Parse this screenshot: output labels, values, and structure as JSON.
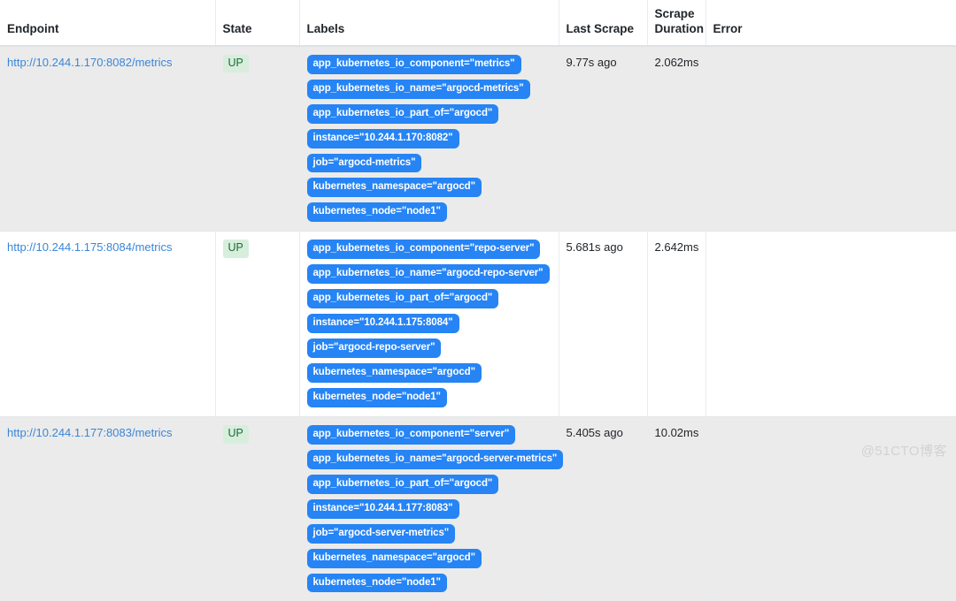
{
  "table": {
    "columns": [
      {
        "key": "endpoint",
        "label": "Endpoint"
      },
      {
        "key": "state",
        "label": "State"
      },
      {
        "key": "labels",
        "label": "Labels"
      },
      {
        "key": "last_scrape",
        "label": "Last Scrape"
      },
      {
        "key": "scrape_duration",
        "label": "Scrape Duration"
      },
      {
        "key": "error",
        "label": "Error"
      }
    ],
    "rows": [
      {
        "endpoint": "http://10.244.1.170:8082/metrics",
        "state": "UP",
        "labels": [
          "app_kubernetes_io_component=\"metrics\"",
          "app_kubernetes_io_name=\"argocd-metrics\"",
          "app_kubernetes_io_part_of=\"argocd\"",
          "instance=\"10.244.1.170:8082\"",
          "job=\"argocd-metrics\"",
          "kubernetes_namespace=\"argocd\"",
          "kubernetes_node=\"node1\""
        ],
        "last_scrape": "9.77s ago",
        "scrape_duration": "2.062ms",
        "error": ""
      },
      {
        "endpoint": "http://10.244.1.175:8084/metrics",
        "state": "UP",
        "labels": [
          "app_kubernetes_io_component=\"repo-server\"",
          "app_kubernetes_io_name=\"argocd-repo-server\"",
          "app_kubernetes_io_part_of=\"argocd\"",
          "instance=\"10.244.1.175:8084\"",
          "job=\"argocd-repo-server\"",
          "kubernetes_namespace=\"argocd\"",
          "kubernetes_node=\"node1\""
        ],
        "last_scrape": "5.681s ago",
        "scrape_duration": "2.642ms",
        "error": ""
      },
      {
        "endpoint": "http://10.244.1.177:8083/metrics",
        "state": "UP",
        "labels": [
          "app_kubernetes_io_component=\"server\"",
          "app_kubernetes_io_name=\"argocd-server-metrics\"",
          "app_kubernetes_io_part_of=\"argocd\"",
          "instance=\"10.244.1.177:8083\"",
          "job=\"argocd-server-metrics\"",
          "kubernetes_namespace=\"argocd\"",
          "kubernetes_node=\"node1\""
        ],
        "last_scrape": "5.405s ago",
        "scrape_duration": "10.02ms",
        "error": ""
      }
    ]
  },
  "colors": {
    "label_badge_bg": "#2684f5",
    "state_up_bg": "#d7eedd",
    "state_up_text": "#1c6b33",
    "link": "#3a86d8",
    "row_striped_bg": "#ebebeb"
  },
  "watermark": {
    "text": "@51CTO博客"
  }
}
